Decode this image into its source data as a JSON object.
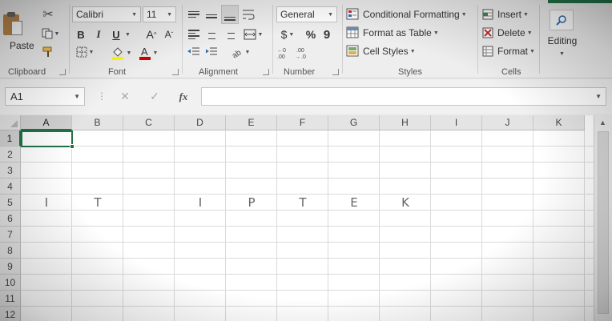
{
  "ribbon": {
    "clipboard": {
      "label": "Clipboard",
      "paste_label": "Paste"
    },
    "font": {
      "label": "Font",
      "font_name": "Calibri",
      "font_size": "11",
      "bold": "B",
      "italic": "I",
      "underline": "U",
      "grow": "A",
      "shrink": "A"
    },
    "alignment": {
      "label": "Alignment"
    },
    "number": {
      "label": "Number",
      "format": "General",
      "currency": "$",
      "percent": "%",
      "comma": "9",
      "inc_decimal": "+0 .00",
      "dec_decimal": ".00 →0"
    },
    "styles": {
      "label": "Styles",
      "conditional_formatting": "Conditional Formatting",
      "format_as_table": "Format as Table",
      "cell_styles": "Cell Styles"
    },
    "cells": {
      "label": "Cells",
      "insert": "Insert",
      "delete": "Delete",
      "format": "Format"
    },
    "editing": {
      "label": "Editing"
    }
  },
  "formula_bar": {
    "name_box": "A1",
    "fx": "fx",
    "formula": ""
  },
  "grid": {
    "columns": [
      "A",
      "B",
      "C",
      "D",
      "E",
      "F",
      "G",
      "H",
      "I",
      "J",
      "K"
    ],
    "rows": [
      "1",
      "2",
      "3",
      "4",
      "5",
      "6",
      "7",
      "8",
      "9",
      "10",
      "11",
      "12"
    ],
    "selected_cell": "A1",
    "row5_values": [
      "I",
      "T",
      "",
      "I",
      "P",
      "T",
      "E",
      "K",
      "",
      "",
      ""
    ]
  },
  "colors": {
    "accent": "#217346",
    "font_color": "#d00000",
    "highlight": "#ffff00"
  }
}
